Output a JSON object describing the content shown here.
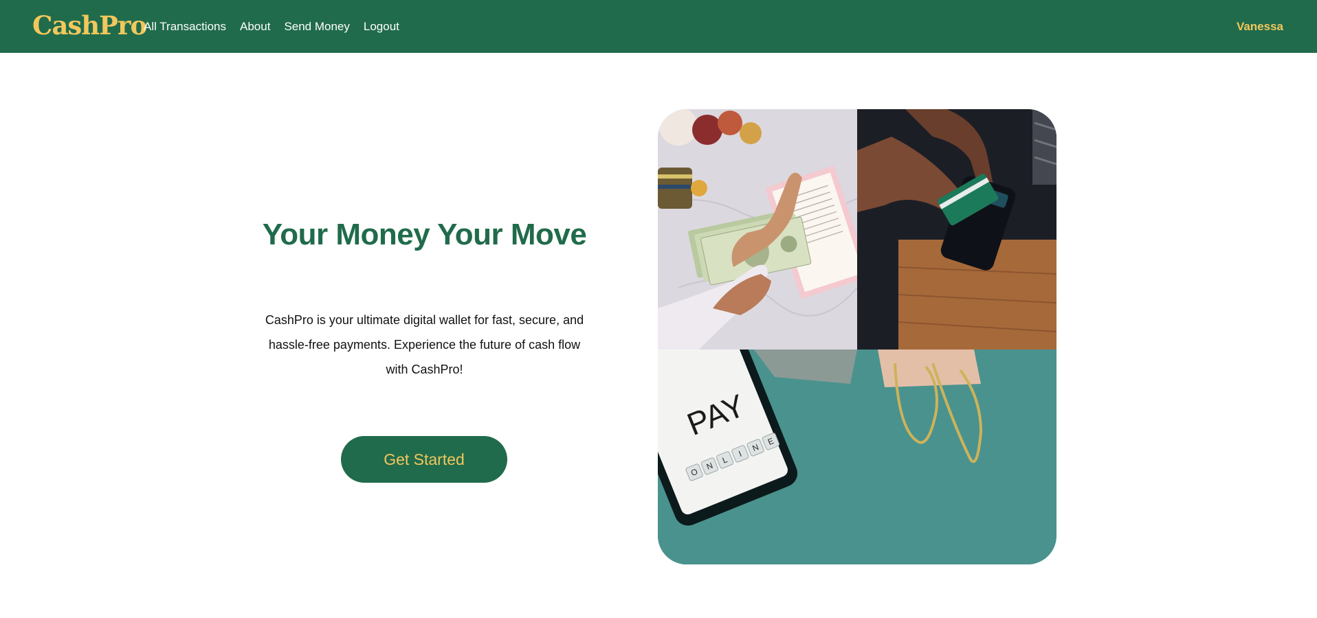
{
  "brand": {
    "name": "CashPro",
    "color": "#f2c75c"
  },
  "nav": {
    "links": [
      "All Transactions",
      "About",
      "Send Money",
      "Logout"
    ],
    "user": "Vanessa"
  },
  "hero": {
    "title": "Your Money Your Move",
    "description": "CashPro is your ultimate digital wallet for fast, secure, and hassle-free payments. Experience the future of cash flow with CashPro!",
    "cta_label": "Get Started"
  },
  "collage": {
    "phone_screen_text": "PAY",
    "phone_tiles": [
      "O",
      "N",
      "L",
      "I",
      "N",
      "E"
    ]
  },
  "colors": {
    "primary": "#206b4b",
    "accent": "#f2c75c",
    "teal": "#4a928e"
  }
}
